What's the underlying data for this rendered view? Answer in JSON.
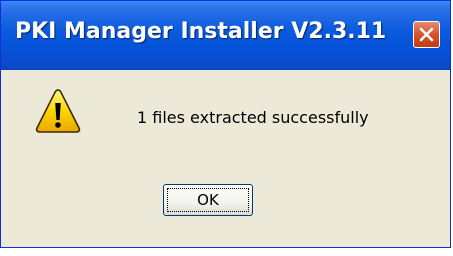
{
  "window": {
    "title": "PKI Manager Installer V2.3.11"
  },
  "dialog": {
    "icon": "warning-icon",
    "message": "1 files extracted successfully",
    "ok_label": "OK"
  },
  "colors": {
    "titlebar": "#0a5ade",
    "dialog_background": "#ece9d8",
    "close_button": "#d4532d",
    "warning_yellow": "#ffd400"
  }
}
